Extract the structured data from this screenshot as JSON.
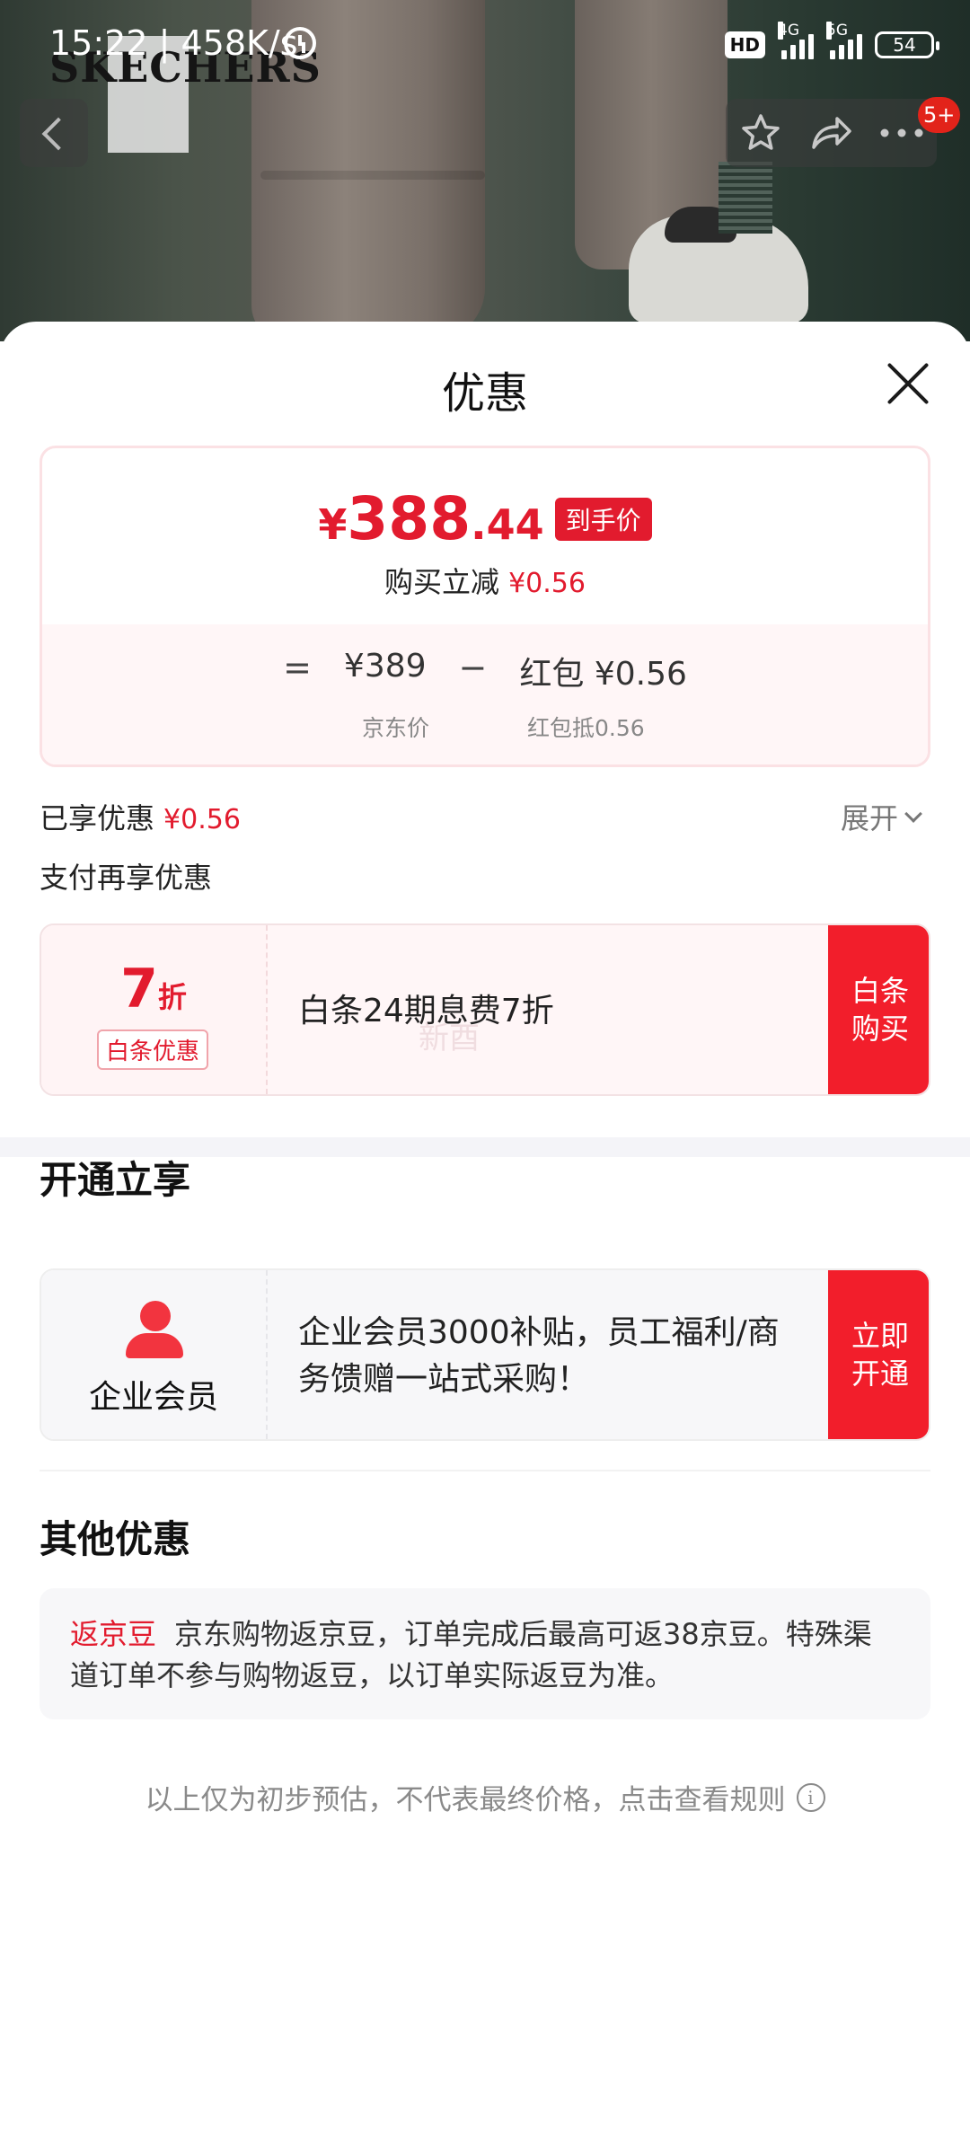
{
  "status_bar": {
    "time": "15:22",
    "speed": "458K/s",
    "hd": "HD",
    "net1": "4G",
    "net2": "5G",
    "battery": "54"
  },
  "photo": {
    "brand": "SKECHERS"
  },
  "nav": {
    "badge": "5+"
  },
  "sheet": {
    "title": "优惠",
    "price_card": {
      "yen": "¥",
      "price_int": "388",
      "price_dec": ".44",
      "tag": "到手价",
      "reduce_label": "购买立减",
      "reduce_value": "¥0.56",
      "calc_eq": "=",
      "jd_price": "¥389",
      "calc_minus": "−",
      "hongbao_value": "红包 ¥0.56",
      "jd_price_label": "京东价",
      "hongbao_label": "红包抵0.56"
    },
    "enjoyed_label": "已享优惠",
    "enjoyed_value": "¥0.56",
    "expand_label": "展开",
    "pay_more_label": "支付再享优惠",
    "baitiao": {
      "discount_num": "7",
      "discount_unit": "折",
      "tag": "白条优惠",
      "text": "白条24期息费7折",
      "watermark": "新酉",
      "button": "白条购买"
    },
    "open_title": "开通立享",
    "enterprise": {
      "label": "企业会员",
      "text": "企业会员3000补贴，员工福利/商务馈赠一站式采购！",
      "button": "立即开通"
    },
    "other_title": "其他优惠",
    "other": {
      "tag": "返京豆",
      "text": "京东购物返京豆，订单完成后最高可返38京豆。特殊渠道订单不参与购物返豆，以订单实际返豆为准。"
    },
    "footnote": "以上仅为初步预估，不代表最终价格，点击查看规则",
    "info_icon": "i"
  },
  "colors": {
    "accent_red": "#e21b2e",
    "button_red": "#f21e2b"
  },
  "icons": [
    "back-icon",
    "star-icon",
    "share-icon",
    "more-icon",
    "close-icon",
    "person-icon",
    "info-icon",
    "chevron-down-icon",
    "alarm-icon"
  ]
}
